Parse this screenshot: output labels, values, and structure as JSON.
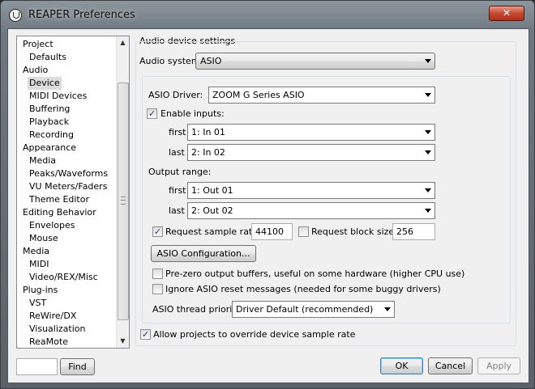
{
  "window": {
    "title": "REAPER Preferences",
    "close_glyph": "✕"
  },
  "tree": {
    "items": [
      {
        "label": "Project",
        "level": 0
      },
      {
        "label": "Defaults",
        "level": 1
      },
      {
        "label": "Audio",
        "level": 0
      },
      {
        "label": "Device",
        "level": 1,
        "selected": true
      },
      {
        "label": "MIDI Devices",
        "level": 1
      },
      {
        "label": "Buffering",
        "level": 1
      },
      {
        "label": "Playback",
        "level": 1
      },
      {
        "label": "Recording",
        "level": 1
      },
      {
        "label": "Appearance",
        "level": 0
      },
      {
        "label": "Media",
        "level": 1
      },
      {
        "label": "Peaks/Waveforms",
        "level": 1
      },
      {
        "label": "VU Meters/Faders",
        "level": 1
      },
      {
        "label": "Theme Editor",
        "level": 1
      },
      {
        "label": "Editing Behavior",
        "level": 0
      },
      {
        "label": "Envelopes",
        "level": 1
      },
      {
        "label": "Mouse",
        "level": 1
      },
      {
        "label": "Media",
        "level": 0
      },
      {
        "label": "MIDI",
        "level": 1
      },
      {
        "label": "Video/REX/Misc",
        "level": 1
      },
      {
        "label": "Plug-ins",
        "level": 0
      },
      {
        "label": "VST",
        "level": 1
      },
      {
        "label": "ReWire/DX",
        "level": 1
      },
      {
        "label": "Visualization",
        "level": 1
      },
      {
        "label": "ReaMote",
        "level": 1
      }
    ],
    "scroll_up_glyph": "▲",
    "scroll_down_glyph": "▼"
  },
  "search": {
    "value": "",
    "find_label": "Find"
  },
  "audio": {
    "section_label": "Audio device settings",
    "system_label": "Audio system:",
    "system_value": "ASIO",
    "driver_label": "ASIO Driver:",
    "driver_value": "ZOOM G Series ASIO",
    "enable_inputs_label": "Enable inputs:",
    "enable_inputs_checked": true,
    "input_first_label": "first",
    "input_first_value": "1:  In 01",
    "input_last_label": "last",
    "input_last_value": "2:  In 02",
    "output_range_label": "Output range:",
    "output_first_label": "first",
    "output_first_value": "1:  Out 01",
    "output_last_label": "last",
    "output_last_value": "2:  Out 02",
    "request_rate_label": "Request sample rate:",
    "request_rate_checked": true,
    "sample_rate_value": "44100",
    "request_block_label": "Request block size:",
    "request_block_checked": false,
    "block_size_value": "256",
    "asio_config_label": "ASIO Configuration...",
    "prezero_label": "Pre-zero output buffers, useful on some hardware (higher CPU use)",
    "prezero_checked": false,
    "ignore_reset_label": "Ignore ASIO reset messages (needed for some buggy drivers)",
    "ignore_reset_checked": false,
    "thread_priority_label": "ASIO thread priority:",
    "thread_priority_value": "Driver Default (recommended)",
    "allow_override_label": "Allow projects to override device sample rate",
    "allow_override_checked": true
  },
  "buttons": {
    "ok": "OK",
    "cancel": "Cancel",
    "apply": "Apply"
  },
  "glyphs": {
    "check": "✓"
  }
}
